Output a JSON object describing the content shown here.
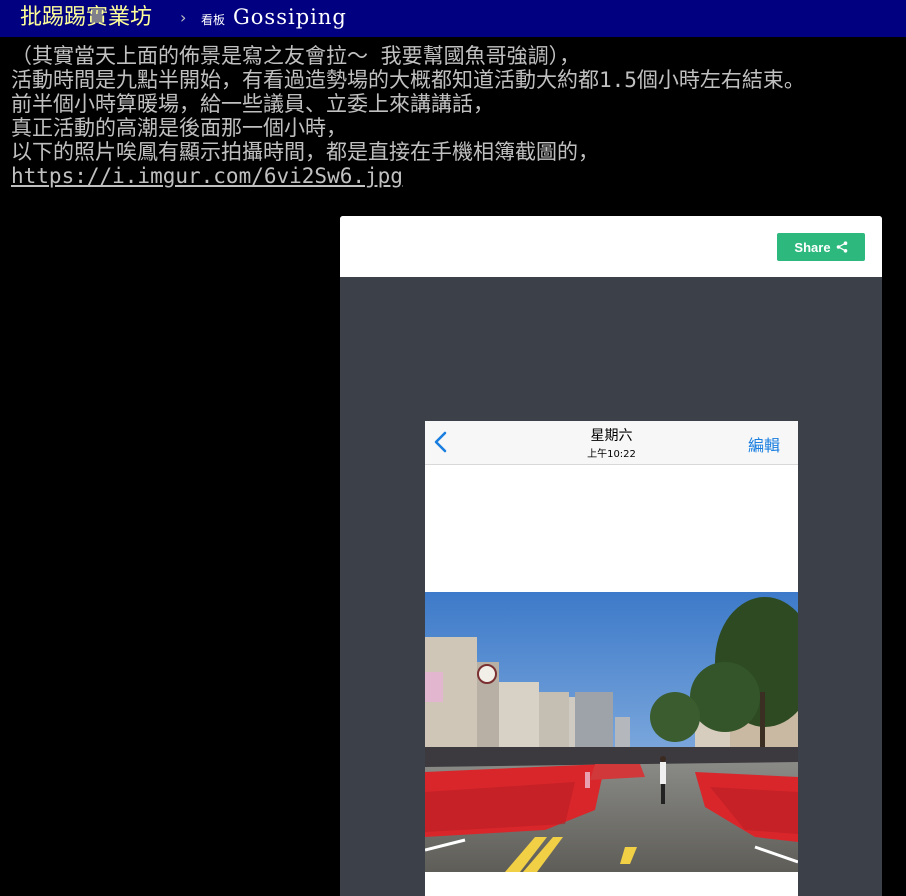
{
  "header": {
    "site_title": "批踢踢實業坊",
    "separator": "›",
    "board_label": "看板",
    "board_name": "Gossiping"
  },
  "post": {
    "lines": [
      "（其實當天上面的佈景是寫之友會拉～ 我要幫國魚哥強調），",
      "活動時間是九點半開始，有看過造勢場的大概都知道活動大約都1.5個小時左右結束。",
      "前半個小時算暖場，給一些議員、立委上來講講話，",
      "真正活動的高潮是後面那一個小時，",
      "以下的照片唉鳳有顯示拍攝時間，都是直接在手機相簿截圖的，"
    ],
    "link": "https://i.imgur.com/6vi2Sw6.jpg"
  },
  "embed": {
    "share_label": "Share",
    "share_color": "#2db87d",
    "phone": {
      "day": "星期六",
      "time": "上午10:22",
      "edit": "編輯"
    }
  },
  "colors": {
    "topbar": "#000080",
    "site_title": "#ffff99",
    "text": "#c0c0c0",
    "embed_bg": "#3b4049"
  }
}
